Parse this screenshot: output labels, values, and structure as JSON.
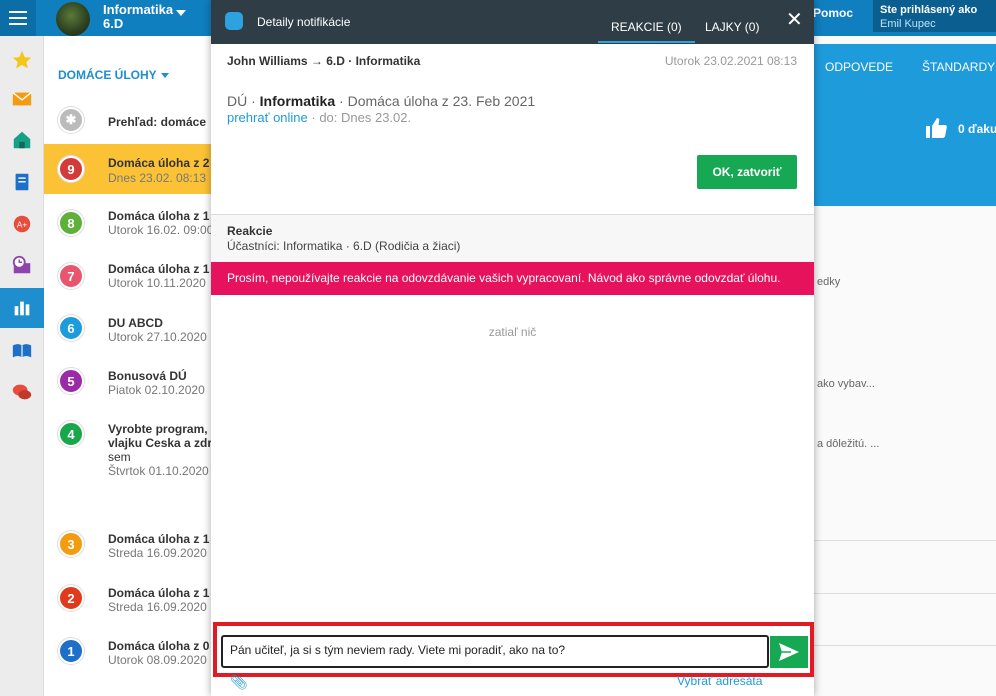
{
  "header": {
    "class_title": "Informatika",
    "class_sub": "6.D",
    "help": "Pomoc",
    "logged_as": "Ste prihlásený ako",
    "user_name": "Emil Kupec"
  },
  "sidebar": {
    "icons": [
      "star-icon",
      "mail-icon",
      "home-icon",
      "notebook-icon",
      "grades-icon",
      "schedule-icon",
      "stats-icon",
      "book-icon",
      "chat-icon"
    ],
    "active": "stats-icon"
  },
  "list": {
    "heading": "DOMÁCE ÚLOHY",
    "overview": "Prehľad: domáce",
    "items": [
      {
        "badge": "9",
        "color": "#d33b3b",
        "title": "Domáca úloha z 2",
        "date": "Dnes 23.02. 08:13",
        "selected": true
      },
      {
        "badge": "8",
        "color": "#5fb03a",
        "title": "Domáca úloha z 1",
        "date": "Utorok 16.02. 09:00"
      },
      {
        "badge": "7",
        "color": "#e8566e",
        "title": "Domáca úloha z 1",
        "date": "Utorok 10.11.2020"
      },
      {
        "badge": "6",
        "color": "#1e9bdb",
        "title": "DU ABCD",
        "date": "Utorok 27.10.2020"
      },
      {
        "badge": "5",
        "color": "#9b2aa6",
        "title": "Bonusová DÚ",
        "date": "Piatok 02.10.2020"
      },
      {
        "badge": "4",
        "color": "#18a84a",
        "title_lines": [
          "Vyrobte program,",
          "vlajku Ceska a zdr",
          "sem"
        ],
        "date": "Štvrtok 01.10.2020"
      },
      {
        "badge": "3",
        "color": "#f39c12",
        "title": "Domáca úloha z 1",
        "date": "Streda 16.09.2020"
      },
      {
        "badge": "2",
        "color": "#e03a1e",
        "title": "Domáca úloha z 1",
        "date": "Streda 16.09.2020"
      },
      {
        "badge": "1",
        "color": "#1e6fc8",
        "title": "Domáca úloha z 0",
        "date": "Utorok 08.09.2020"
      }
    ]
  },
  "right": {
    "tab_answers": "ODPOVEDE",
    "tab_standards": "ŠTANDARDY",
    "likes": "0 ďaku",
    "frag1": "edky",
    "frag2": "ako vybav...",
    "frag3": "a dôležitú. ..."
  },
  "modal": {
    "title": "Detaily notifikácie",
    "tab_reactions": "REAKCIE (0)",
    "tab_likes": "LAJKY (0)",
    "sender": "John Williams → 6.D · Informatika",
    "date": "Utorok 23.02.2021 08:13",
    "note_prefix": "DÚ ·",
    "note_subject": "Informatika",
    "note_rest": "· Domáca úloha z 23. Feb 2021",
    "play_online": "prehrať online",
    "due": "· do: Dnes 23.02.",
    "ok_button": "OK, zatvoriť",
    "reactions_title": "Reakcie",
    "participants": "Účastníci: Informatika · 6.D (Rodičia a žiaci)",
    "warning": "Prosím, nepoužívajte reakcie na odovzdávanie vašich vypracovaní. Návod ako správne odovzdať úlohu.",
    "empty": "zatiaľ nič",
    "message_value": "Pán učiteľ, ja si s tým neviem rady. Viete mi poradiť, ako na to?",
    "select_recipient": "Vybrať adresáta"
  }
}
